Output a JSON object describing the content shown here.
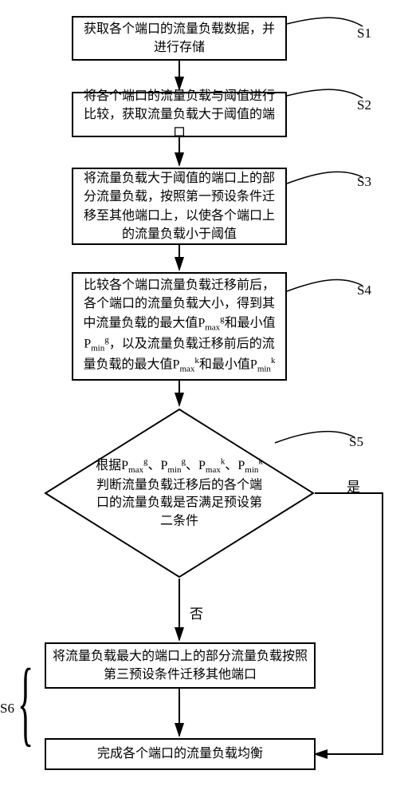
{
  "chart_data": {
    "type": "flowchart",
    "nodes": [
      {
        "id": "S1",
        "shape": "rect",
        "text": "获取各个端口的流量负载数据，并进行存储",
        "label": "S1"
      },
      {
        "id": "S2",
        "shape": "rect",
        "text": "将各个端口的流量负载与阈值进行比较，获取流量负载大于阈值的端口",
        "label": "S2"
      },
      {
        "id": "S3",
        "shape": "rect",
        "text": "将流量负载大于阈值的端口上的部分流量负载，按照第一预设条件迁移至其他端口上，以使各个端口上的流量负载小于阈值",
        "label": "S3"
      },
      {
        "id": "S4",
        "shape": "rect",
        "text_html": "比较各个端口流量负载迁移前后，各个端口的流量负载大小，得到其中流量负载的最大值P<span class='sub'>max</span><span class='sup'>g</span>和最小值P<span class='sub'>min</span><span class='sup'>g</span>，以及流量负载迁移前后的流量负载的最大值P<span class='sub'>max</span><span class='sup'>k</span>和最小值P<span class='sub'>min</span><span class='sup'>k</span>",
        "label": "S4"
      },
      {
        "id": "S5",
        "shape": "diamond",
        "text_html": "根据P<span class='sub'>max</span><span class='sup'>g</span>、P<span class='sub'>min</span><span class='sup'>g</span>、P<span class='sub'>max</span><span class='sup'>k</span>、P<span class='sub'>min</span><span class='sup'>k</span><br>判断流量负载迁移后的各个端口的流量负载是否满足预设第二条件",
        "label": "S5"
      },
      {
        "id": "S6a",
        "shape": "rect",
        "text": "将流量负载最大的端口上的部分流量负载按照第三预设条件迁移其他端口",
        "group": "S6"
      },
      {
        "id": "S6b",
        "shape": "rect",
        "text": "完成各个端口的流量负载均衡",
        "group": "S6"
      }
    ],
    "edges": [
      {
        "from": "S1",
        "to": "S2"
      },
      {
        "from": "S2",
        "to": "S3"
      },
      {
        "from": "S3",
        "to": "S4"
      },
      {
        "from": "S4",
        "to": "S5"
      },
      {
        "from": "S5",
        "to": "S6a",
        "label": "否"
      },
      {
        "from": "S5",
        "to": "S6b",
        "label": "是"
      },
      {
        "from": "S6a",
        "to": "S6b"
      }
    ],
    "groups": [
      {
        "id": "S6",
        "label": "S6",
        "members": [
          "S6a",
          "S6b"
        ]
      }
    ]
  },
  "labels": {
    "s1": "S1",
    "s2": "S2",
    "s3": "S3",
    "s4": "S4",
    "s5": "S5",
    "s6": "S6",
    "yes": "是",
    "no": "否"
  },
  "boxes": {
    "s1": "获取各个端口的流量负载数据，并进行存储",
    "s2": "将各个端口的流量负载与阈值进行比较，获取流量负载大于阈值的端口",
    "s3": "将流量负载大于阈值的端口上的部分流量负载，按照第一预设条件迁移至其他端口上，以使各个端口上的流量负载小于阈值",
    "s6a": "将流量负载最大的端口上的部分流量负载按照第三预设条件迁移其他端口",
    "s6b": "完成各个端口的流量负载均衡"
  }
}
